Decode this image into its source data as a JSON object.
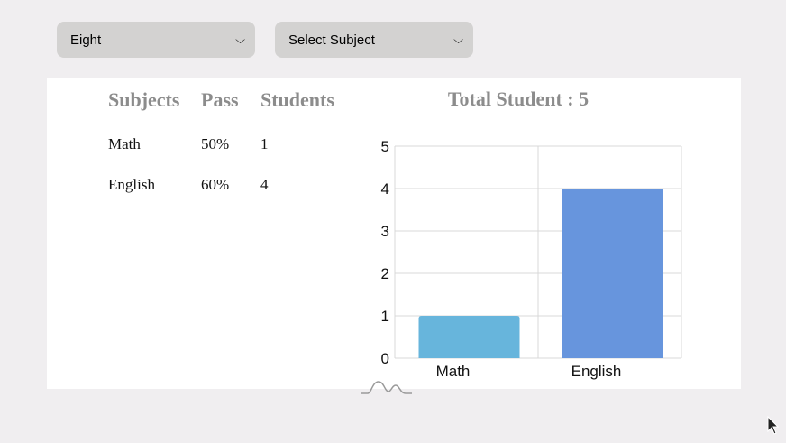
{
  "filters": {
    "class_value": "Eight",
    "subject_value": "Select Subject"
  },
  "table": {
    "headers": [
      "Subjects",
      "Pass",
      "Students"
    ],
    "rows": [
      {
        "subject": "Math",
        "pass": "50%",
        "students": "1"
      },
      {
        "subject": "English",
        "pass": "60%",
        "students": "4"
      }
    ]
  },
  "chart_title": "Total Student : 5",
  "chart_data": {
    "type": "bar",
    "categories": [
      "Math",
      "English"
    ],
    "values": [
      1,
      4
    ],
    "ylim": [
      0,
      5
    ],
    "yticks": [
      "0",
      "1",
      "2",
      "3",
      "4",
      "5"
    ],
    "grid": true,
    "colors": [
      "#67b5dc",
      "#6795dd"
    ]
  }
}
